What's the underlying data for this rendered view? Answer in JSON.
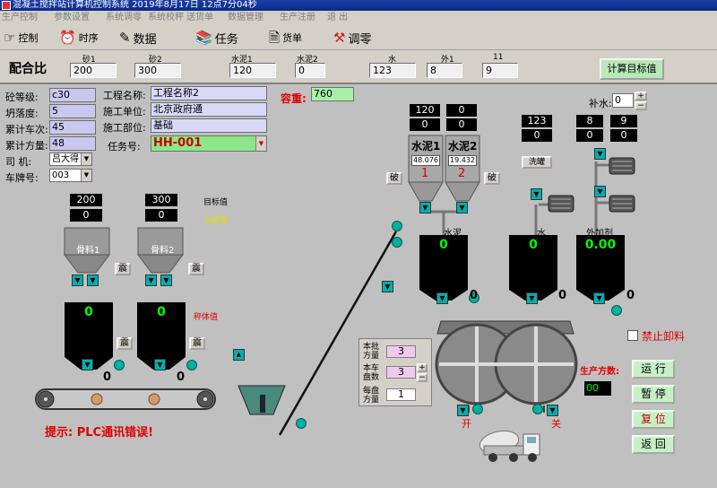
{
  "title": "混凝土搅拌站计算机控制系统 2019年8月17日 12点7分04秒",
  "menu": [
    "生产控制",
    "参数设置",
    "系统调零",
    "系统校秤",
    "送货单",
    "数据管理",
    "生产注册",
    "退 出"
  ],
  "toolbar": {
    "control": "控制",
    "timing": "时序",
    "data": "数据",
    "tasks": "任务",
    "invoice": "货单",
    "zero": "调零"
  },
  "mix": {
    "label": "配合比",
    "caps": [
      "砂1",
      "砂2",
      "水泥1",
      "水泥2",
      "水",
      "外1",
      "11"
    ],
    "values": [
      "200",
      "300",
      "120",
      "0",
      "123",
      "8",
      "9"
    ],
    "calc_button": "计算目标值"
  },
  "form": {
    "grade_label": "砼等级:",
    "grade": "c30",
    "slump_label": "坍落度:",
    "slump": "5",
    "trips_label": "累计车次:",
    "trips": "45",
    "volume_label": "累计方量:",
    "volume": "48",
    "driver_label": "司  机:",
    "driver": "吕大得",
    "truck_label": "车牌号:",
    "truck": "003",
    "project_label": "工程名称:",
    "project": "工程名称2",
    "unit_label": "施工单位:",
    "unit": "北京政府通",
    "part_label": "施工部位:",
    "part": "基础",
    "task_label": "任务号:",
    "task": "HH-001",
    "density_label": "容重:",
    "density": "760"
  },
  "plant": {
    "target_label": "目标值",
    "current_label": "当前值",
    "weight_label": "秤体值",
    "agg1_target": "200",
    "agg1_current": "0",
    "agg2_target": "300",
    "agg2_current": "0",
    "agg1_name": "骨料1",
    "agg2_name": "骨料2",
    "agg1_scale": "0",
    "agg2_scale": "0",
    "agg1_out": "0",
    "agg2_out": "0",
    "shake": "震",
    "cem1_target": "120",
    "cem1_current": "0",
    "cem2_target": "0",
    "cem2_current": "0",
    "cem1_name": "水泥1",
    "cem2_name": "水泥2",
    "cem1_level": "48.076",
    "cem2_level": "19.432",
    "cem1_no": "1",
    "cem2_no": "2",
    "break": "破",
    "water_target": "123",
    "water_current": "0",
    "add1_target": "8",
    "add1_current": "0",
    "add2_target": "9",
    "add2_current": "0",
    "flush": "洗罐",
    "supp_water_label": "补水:",
    "supp_water": "0",
    "cement_scale_label": "水泥",
    "water_scale_label": "水",
    "add_scale_label": "外加剂",
    "cement_scale": "0",
    "water_scale": "0",
    "add_scale": "0.00",
    "cement_out": "0",
    "water_out": "0",
    "add_out": "0",
    "open": "开",
    "close": "关",
    "plc_msg": "提示: PLC通讯错误!"
  },
  "batch": {
    "this_label": "本批方量",
    "this_value": "3",
    "truck_label": "本车盘数",
    "truck_value": "3",
    "each_label": "每盘方量",
    "each_value": "1"
  },
  "side": {
    "no_unload": "禁止卸料",
    "prod_label": "生产方数:",
    "prod_value": "00",
    "run": "运 行",
    "pause": "暂 停",
    "reset": "复 位",
    "back": "返 回"
  },
  "colors": {
    "accent_red": "#e00000",
    "valve": "#00b0b0",
    "field_bg": "#c8c8f0",
    "display_green": "#00ff00"
  }
}
